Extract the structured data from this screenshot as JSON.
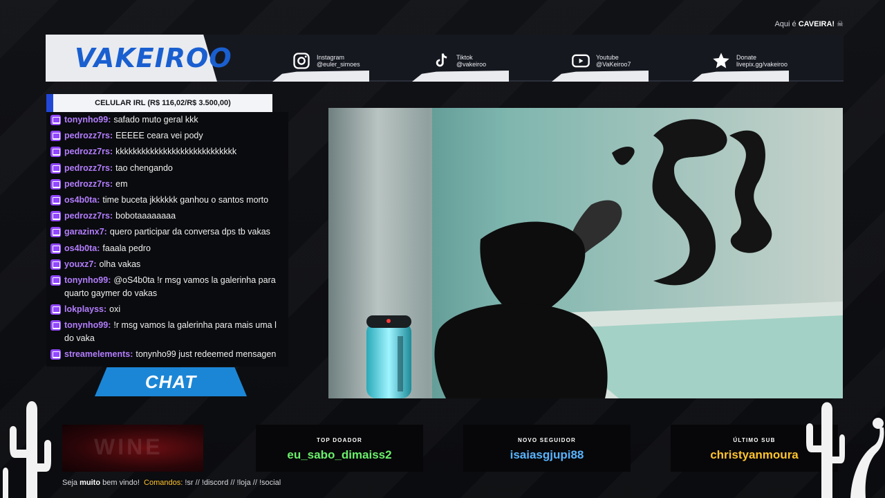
{
  "topbar": {
    "prefix": "Aqui é",
    "brand": "CAVEIRA!",
    "skull_icon": "skull-icon"
  },
  "logo": {
    "text": "VAKEIROO"
  },
  "socials": [
    {
      "icon": "instagram-icon",
      "name": "Instagram",
      "handle": "@euler_simoes"
    },
    {
      "icon": "tiktok-icon",
      "name": "Tiktok",
      "handle": "@vakeiroo"
    },
    {
      "icon": "youtube-icon",
      "name": "Youtube",
      "handle": "@VaKeiroo7"
    },
    {
      "icon": "star-icon",
      "name": "Donate",
      "handle": "livepix.gg/vakeiroo"
    }
  ],
  "goal": {
    "label": "CELULAR IRL (R$ 116,02/R$ 3.500,00)"
  },
  "chat": {
    "tab_label": "CHAT",
    "messages": [
      {
        "user": "tonynho99:",
        "text": "safado muto geral kkk"
      },
      {
        "user": "pedrozz7rs:",
        "text": "EEEEE ceara vei pody"
      },
      {
        "user": "pedrozz7rs:",
        "text": "kkkkkkkkkkkkkkkkkkkkkkkkkkkk"
      },
      {
        "user": "pedrozz7rs:",
        "text": "tao chengando"
      },
      {
        "user": "pedrozz7rs:",
        "text": "em"
      },
      {
        "user": "os4b0ta:",
        "text": "time buceta jkkkkkk ganhou o santos morto"
      },
      {
        "user": "pedrozz7rs:",
        "text": "bobotaaaaaaaa"
      },
      {
        "user": "garazinx7:",
        "text": "quero participar da conversa dps tb vakas"
      },
      {
        "user": "os4b0ta:",
        "text": "faaala pedro"
      },
      {
        "user": "youxz7:",
        "text": "olha vakas"
      },
      {
        "user": "tonynho99:",
        "text": "@oS4b0ta !r msg vamos la galerinha para quarto gaymer do vakas"
      },
      {
        "user": "lokplayss:",
        "text": "oxi"
      },
      {
        "user": "tonynho99:",
        "text": "!r msg vamos la galerinha para mais uma l do vaka"
      },
      {
        "user": "streamelements:",
        "text": "tonynho99 just redeemed mensagen"
      }
    ]
  },
  "panels": {
    "ad_text": "WINE",
    "top_donor": {
      "title": "TOP DOADOR",
      "value": "eu_sabo_dimaiss2",
      "color": "#6bf06b"
    },
    "new_follower": {
      "title": "NOVO SEGUIDOR",
      "value": "isaiasgjupi88",
      "color": "#58b4ff"
    },
    "last_sub": {
      "title": "ÚLTIMO SUB",
      "value": "christyanmoura",
      "color": "#ffc42e"
    }
  },
  "footer": {
    "welcome_prefix": "Seja",
    "welcome_strong": "muito",
    "welcome_suffix": "bem vindo!",
    "commands_label": "Comandos:",
    "commands": "!sr // !discord // !loja // !social"
  },
  "colors": {
    "accent_blue": "#1c86d6",
    "twitch_purple": "#9147ff",
    "username": "#b37dff"
  }
}
